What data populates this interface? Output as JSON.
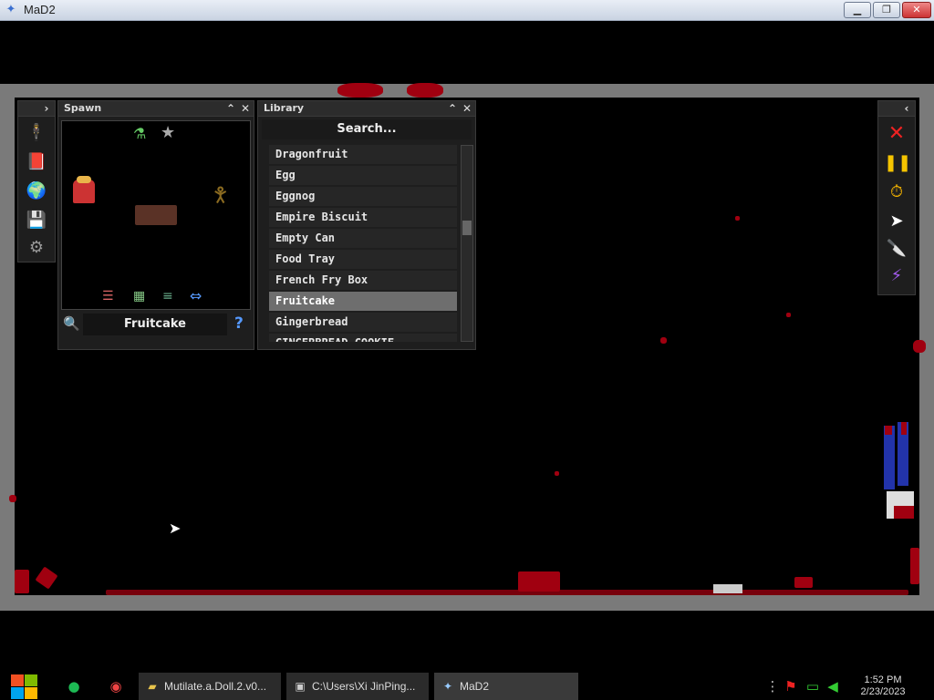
{
  "window": {
    "title": "MaD2",
    "app_icon": "doll-icon"
  },
  "spawn_panel": {
    "title": "Spawn",
    "selected_name": "Fruitcake",
    "items": [
      "flask-icon",
      "star-icon",
      "fry-box-sprite",
      "fruitcake-sprite",
      "gingerbread-sprite"
    ],
    "controls": [
      "sliders-icon",
      "grid-icon",
      "layers-icon",
      "swap-arrows-icon"
    ]
  },
  "library_panel": {
    "title": "Library",
    "search_placeholder": "Search...",
    "items": [
      "Dragonfruit",
      "Egg",
      "Eggnog",
      "Empire Biscuit",
      "Empty Can",
      "Food Tray",
      "French Fry Box",
      "Fruitcake",
      "Gingerbread",
      "GINGERBREAD COOKIE"
    ],
    "selected": "Fruitcake"
  },
  "left_toolbar": [
    "ragdoll-icon",
    "book-icon",
    "globe-icon",
    "save-icon",
    "settings-gear-icon"
  ],
  "right_toolbar": [
    "close-x-icon",
    "pause-icon",
    "stopwatch-icon",
    "cursor-icon",
    "knife-icon",
    "lightning-icon"
  ],
  "taskbar": {
    "tasks": [
      {
        "label": "Mutilate.a.Doll.2.v0...",
        "icon": "folder-icon"
      },
      {
        "label": "C:\\Users\\Xi JinPing...",
        "icon": "cmd-icon"
      },
      {
        "label": "MaD2",
        "icon": "doll-icon"
      }
    ],
    "clock_time": "1:52 PM",
    "clock_date": "2/23/2023"
  },
  "colors": {
    "blood": "#a00010",
    "selected_item": "#6e6e6e",
    "panel_bg": "#1e1e1e"
  }
}
